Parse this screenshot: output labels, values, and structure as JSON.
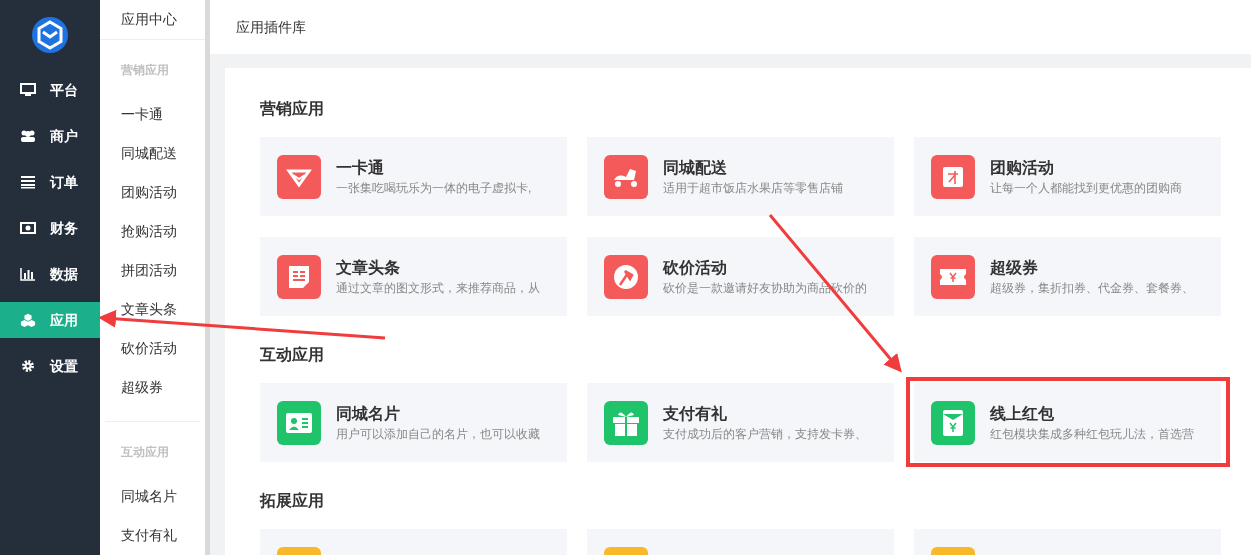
{
  "nav": [
    {
      "label": "平台",
      "selected": false
    },
    {
      "label": "商户",
      "selected": false
    },
    {
      "label": "订单",
      "selected": false
    },
    {
      "label": "财务",
      "selected": false
    },
    {
      "label": "数据",
      "selected": false
    },
    {
      "label": "应用",
      "selected": true
    },
    {
      "label": "设置",
      "selected": false
    }
  ],
  "submenu": {
    "title": "应用中心",
    "groups": [
      {
        "label": "营销应用",
        "items": [
          "一卡通",
          "同城配送",
          "团购活动",
          "抢购活动",
          "拼团活动",
          "文章头条",
          "砍价活动",
          "超级券"
        ]
      },
      {
        "label": "互动应用",
        "items": [
          "同城名片",
          "支付有礼"
        ]
      }
    ]
  },
  "header": {
    "title": "应用插件库"
  },
  "sections": [
    {
      "title": "营销应用",
      "cards": [
        {
          "kind": "app",
          "title": "一卡通",
          "desc": "一张集吃喝玩乐为一体的电子虚拟卡,"
        },
        {
          "kind": "app",
          "title": "同城配送",
          "desc": "适用于超市饭店水果店等零售店铺"
        },
        {
          "kind": "app",
          "title": "团购活动",
          "desc": "让每一个人都能找到更优惠的团购商"
        },
        {
          "kind": "app",
          "title": "文章头条",
          "desc": "通过文章的图文形式，来推荐商品，从"
        },
        {
          "kind": "app",
          "title": "砍价活动",
          "desc": "砍价是一款邀请好友协助为商品砍价的"
        },
        {
          "kind": "app",
          "title": "超级券",
          "desc": "超级券，集折扣券、代金券、套餐券、"
        }
      ]
    },
    {
      "title": "互动应用",
      "cards": [
        {
          "kind": "app",
          "title": "同城名片",
          "desc": "用户可以添加自己的名片，也可以收藏"
        },
        {
          "kind": "app",
          "title": "支付有礼",
          "desc": "支付成功后的客户营销，支持发卡券、"
        },
        {
          "kind": "app",
          "title": "线上红包",
          "desc": "红包模块集成多种红包玩儿法，首选营"
        }
      ]
    },
    {
      "title": "拓展应用",
      "cards": [
        {
          "kind": "stub"
        },
        {
          "kind": "stub"
        },
        {
          "kind": "stub"
        }
      ]
    }
  ]
}
